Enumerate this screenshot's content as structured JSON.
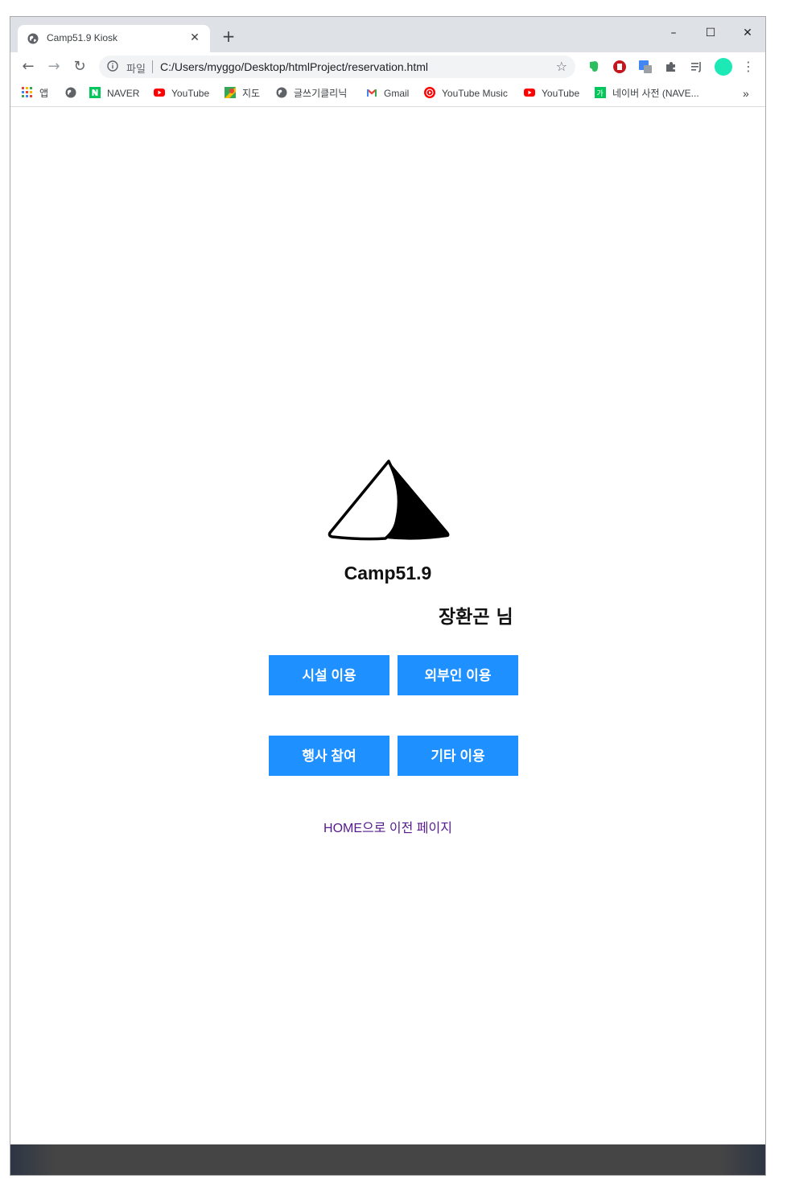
{
  "browser": {
    "tab_title": "Camp51.9 Kiosk",
    "tab_close": "✕",
    "new_tab": "+",
    "window_controls": {
      "minimize": "–",
      "maximize": "☐",
      "close": "✕"
    },
    "nav": {
      "back": "←",
      "forward": "→",
      "reload": "↻"
    },
    "address": {
      "scheme_label": "파일",
      "url": "C:/Users/myggo/Desktop/htmlProject/reservation.html"
    },
    "extensions": [
      "evernote-icon",
      "adblock-icon",
      "translate-icon",
      "puzzle-icon",
      "media-icon",
      "profile-avatar-icon"
    ],
    "bookmarks": [
      {
        "label": "앱",
        "icon": "apps-grid-icon"
      },
      {
        "label": "",
        "icon": "globe-icon"
      },
      {
        "label": "NAVER",
        "icon": "naver-icon"
      },
      {
        "label": "YouTube",
        "icon": "youtube-icon"
      },
      {
        "label": "지도",
        "icon": "maps-icon"
      },
      {
        "label": "글쓰기클리닉",
        "icon": "globe-icon"
      },
      {
        "label": "Gmail",
        "icon": "gmail-icon"
      },
      {
        "label": "YouTube Music",
        "icon": "youtube-music-icon"
      },
      {
        "label": "YouTube",
        "icon": "youtube-icon"
      },
      {
        "label": "네이버 사전 (NAVE...",
        "icon": "naver-dict-icon"
      }
    ],
    "bookmarks_overflow": "»"
  },
  "page": {
    "brand": "Camp51.9",
    "user_greeting": "장환곤 님",
    "buttons": {
      "facility": "시설 이용",
      "outsider": "외부인 이용",
      "event": "행사 참여",
      "other": "기타 이용"
    },
    "back_link": "HOME으로 이전 페이지"
  },
  "colors": {
    "button_bg": "#1e90ff",
    "link": "#551a8b",
    "footer": "#454545"
  }
}
